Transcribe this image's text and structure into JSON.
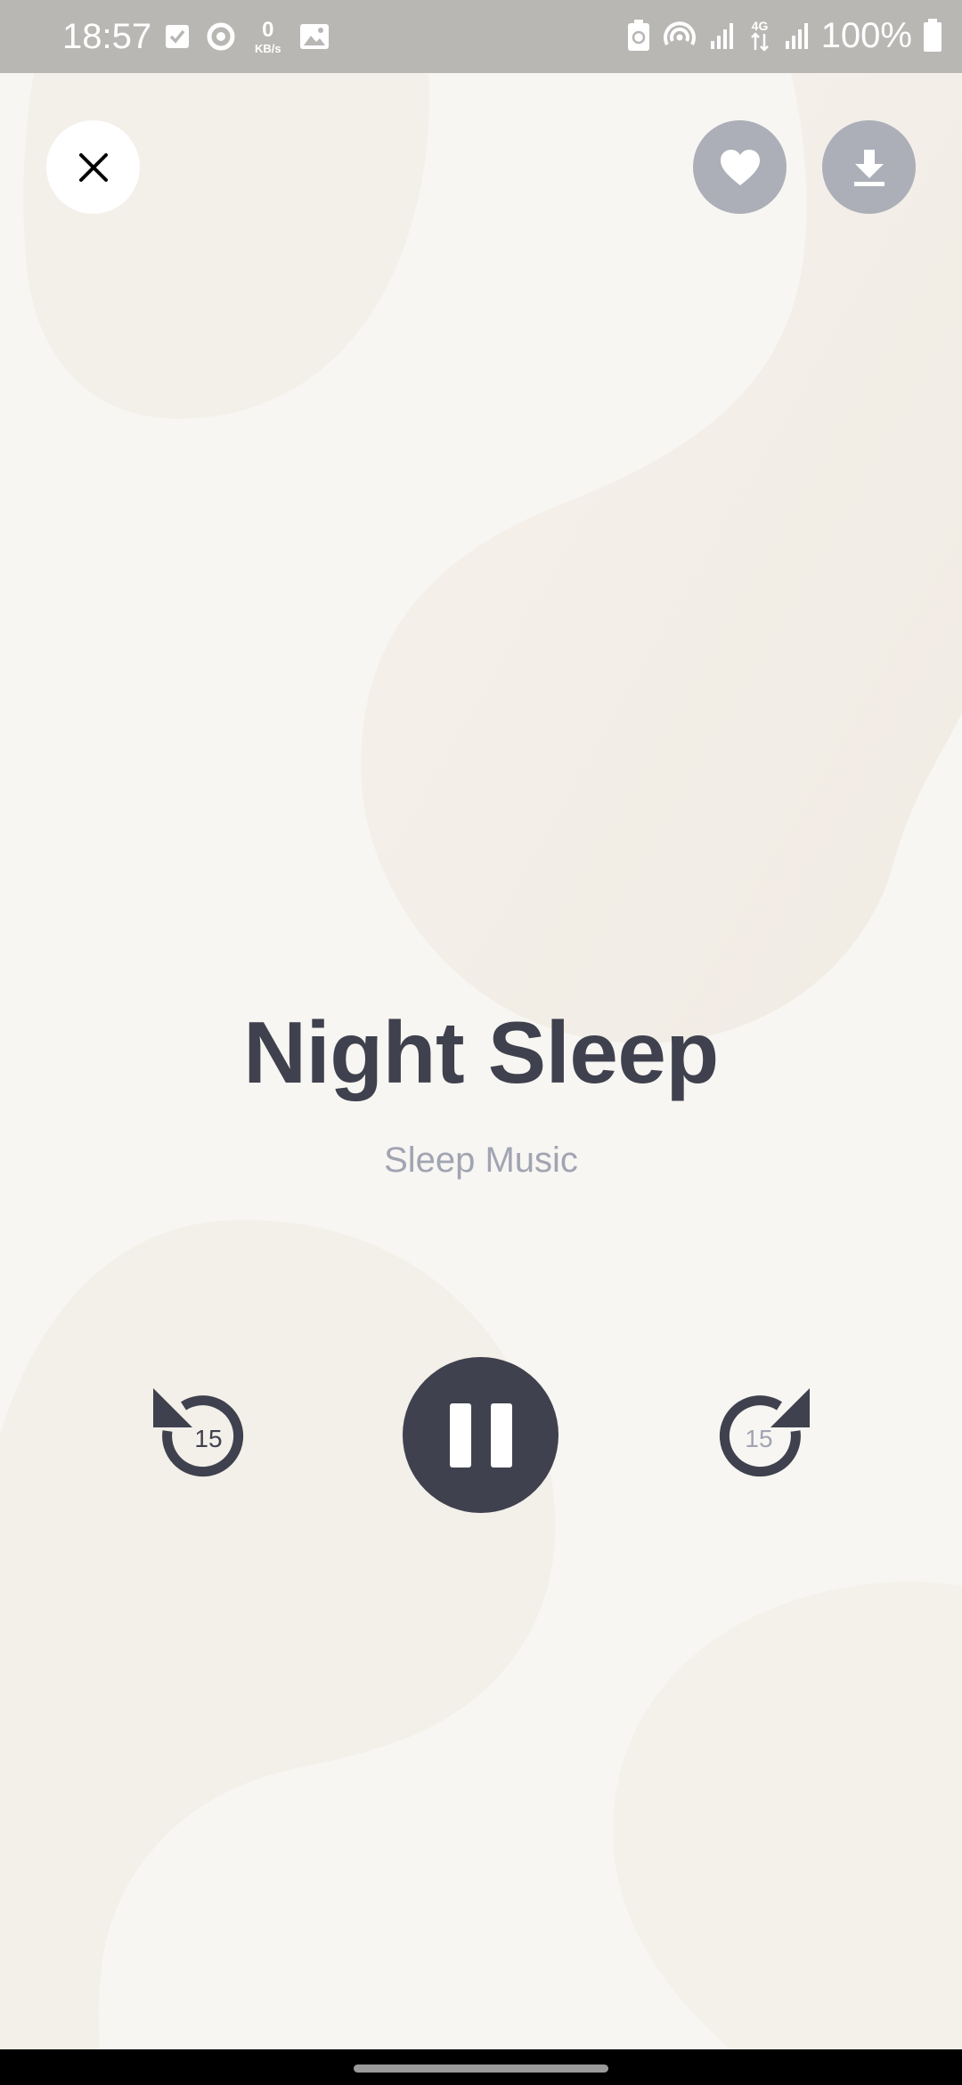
{
  "status_bar": {
    "time": "18:57",
    "net_speed_value": "0",
    "net_speed_unit": "KB/s",
    "network_type": "4G",
    "battery_percent": "100%",
    "icons_left": [
      "check-notification-icon",
      "sync-icon",
      "image-icon"
    ],
    "icons_right": [
      "battery-saver-icon",
      "hotspot-icon",
      "signal-icon",
      "signal-4g-icon",
      "signal-icon",
      "battery-icon"
    ]
  },
  "top_controls": {
    "close_icon": "close-icon",
    "favorite_icon": "heart-icon",
    "download_icon": "download-icon"
  },
  "track": {
    "title": "Night Sleep",
    "subtitle": "Sleep Music"
  },
  "player": {
    "rewind_seconds": "15",
    "forward_seconds": "15",
    "state_icon": "pause-icon"
  },
  "colors": {
    "background": "#f8f6f2",
    "primary_dark": "#3f414e",
    "muted_text": "#a1a4b2",
    "button_gray": "#acafb8",
    "status_bar": "#b8b7b4"
  }
}
